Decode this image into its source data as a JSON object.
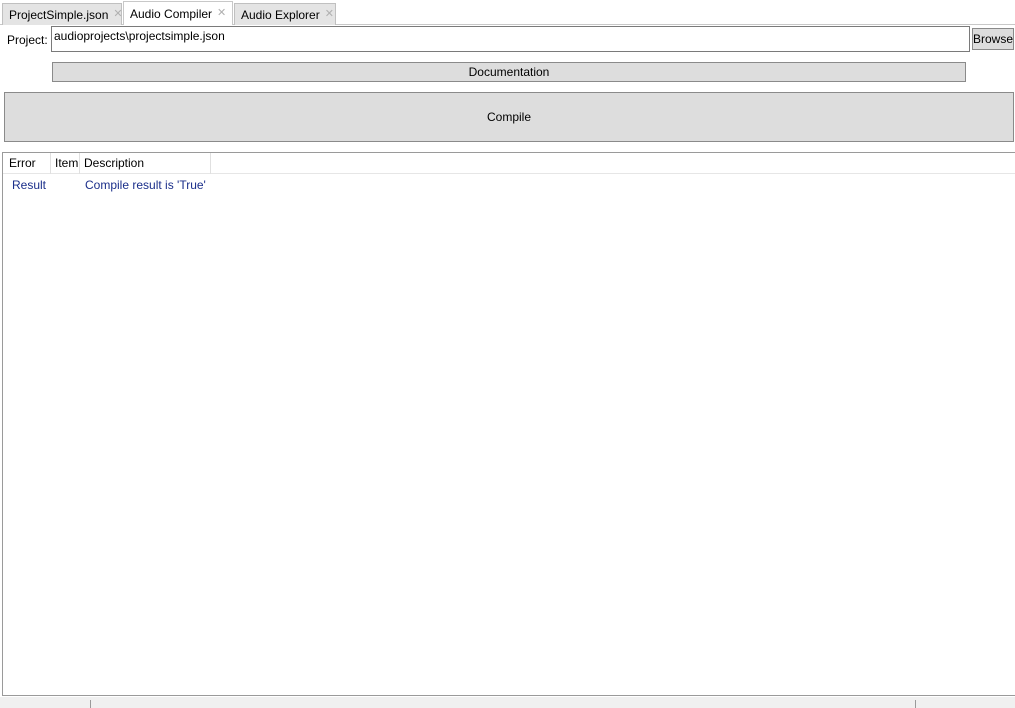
{
  "tabs": [
    {
      "label": "ProjectSimple.json",
      "active": false
    },
    {
      "label": "Audio Compiler",
      "active": true
    },
    {
      "label": "Audio Explorer",
      "active": false
    }
  ],
  "project": {
    "label": "Project:",
    "value": "audioprojects\\projectsimple.json",
    "browse_label": "Browse"
  },
  "documentation_label": "Documentation",
  "compile_label": "Compile",
  "results": {
    "columns": [
      "Error",
      "Item",
      "Description"
    ],
    "rows": [
      {
        "error": "Result",
        "item": "",
        "description": "Compile result is 'True'"
      }
    ]
  },
  "colors": {
    "button_bg": "#dddddd",
    "result_text": "#1a2e8a"
  }
}
